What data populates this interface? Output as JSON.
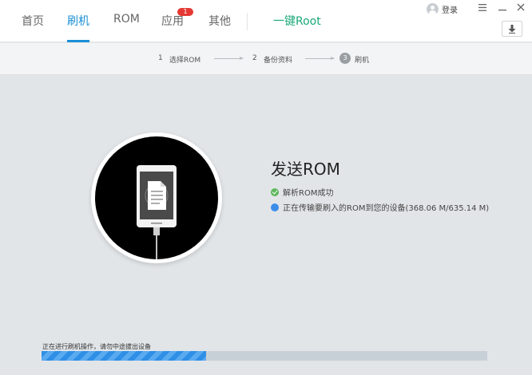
{
  "nav": {
    "home": "首页",
    "flash": "刷机",
    "rom": "ROM",
    "apps": "应用",
    "apps_badge": "1",
    "other": "其他",
    "root": "一键Root"
  },
  "header": {
    "login": "登录"
  },
  "steps": {
    "step1_num": "1",
    "step1_label": "选择ROM",
    "step2_num": "2",
    "step2_label": "备份资料",
    "step3_num": "3",
    "step3_label": "刷机"
  },
  "content": {
    "title": "发送ROM",
    "status_parse": "解析ROM成功",
    "status_transfer": "正在传输要刷入的ROM到您的设备(368.06 M/635.14 M)"
  },
  "progress": {
    "label": "正在进行刷机操作，请勿中途拔出设备",
    "fraction": 0.37
  },
  "colors": {
    "accent": "#1a8fd6",
    "root": "#1ba97a",
    "success": "#5cb85c",
    "info": "#3b8de8",
    "badge": "#e53935"
  },
  "icons": {
    "avatar": "user-avatar-icon",
    "menu": "menu-icon",
    "minimize": "minimize-icon",
    "close": "close-icon",
    "download": "download-icon",
    "phone": "phone-document-icon",
    "success": "check-circle-icon",
    "info": "info-dot-icon"
  }
}
